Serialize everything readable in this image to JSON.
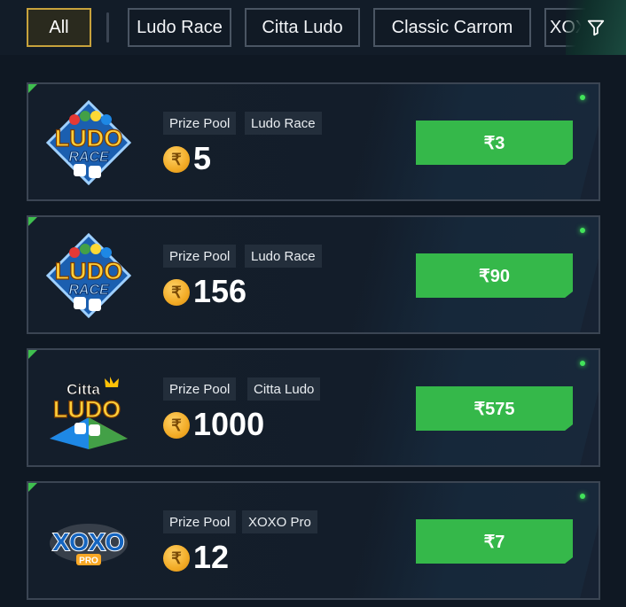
{
  "filters": {
    "chips": [
      "All",
      "Ludo Race",
      "Citta Ludo",
      "Classic Carrom",
      "XOXO"
    ],
    "active": "All",
    "filter_icon": "funnel-icon"
  },
  "cards": [
    {
      "logo": "Ludo Race",
      "logo_top": "LUDO",
      "logo_bottom": "RACE",
      "tag_label": "Prize Pool",
      "game": "Ludo Race",
      "currency": "₹",
      "prize": "5",
      "entry": "₹3"
    },
    {
      "logo": "Ludo Race",
      "logo_top": "LUDO",
      "logo_bottom": "RACE",
      "tag_label": "Prize Pool",
      "game": "Ludo Race",
      "currency": "₹",
      "prize": "156",
      "entry": "₹90"
    },
    {
      "logo": "Citta Ludo",
      "logo_top": "Citta",
      "logo_bottom": "LUDO",
      "tag_label": "Prize Pool",
      "game": "Citta Ludo",
      "currency": "₹",
      "prize": "1000",
      "entry": "₹575"
    },
    {
      "logo": "XOXO Pro",
      "logo_top": "XOXO",
      "logo_bottom": "PRO",
      "tag_label": "Prize Pool",
      "game": "XOXO Pro",
      "currency": "₹",
      "prize": "12",
      "entry": "₹7"
    }
  ],
  "colors": {
    "background": "#0f1823",
    "accent_green": "#35b84a",
    "active_chip_border": "#c7a23c",
    "coin": "#f2ab26"
  }
}
